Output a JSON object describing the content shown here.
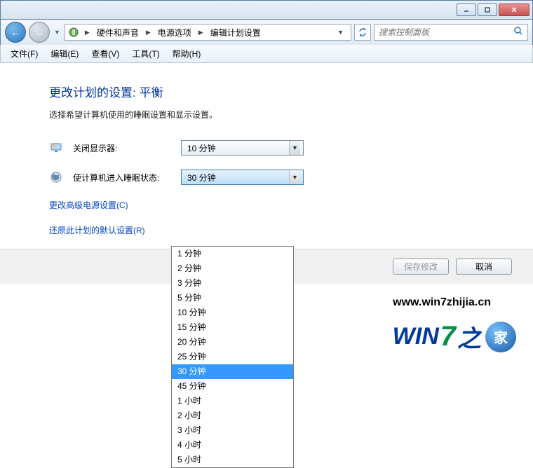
{
  "titlebar": {
    "min": "_",
    "max": "□",
    "close": "✕"
  },
  "nav": {
    "back": "←",
    "fwd": "→"
  },
  "breadcrumb": {
    "c1": "硬件和声音",
    "c2": "电源选项",
    "c3": "编辑计划设置"
  },
  "search": {
    "placeholder": "搜索控制面板"
  },
  "menu": {
    "file": "文件(F)",
    "edit": "编辑(E)",
    "view": "查看(V)",
    "tools": "工具(T)",
    "help": "帮助(H)"
  },
  "page": {
    "heading": "更改计划的设置: 平衡",
    "sub": "选择希望计算机使用的睡眠设置和显示设置。",
    "row1_label": "关闭显示器:",
    "row1_value": "10 分钟",
    "row2_label": "使计算机进入睡眠状态:",
    "row2_value": "30 分钟",
    "link1": "更改高级电源设置(C)",
    "link2": "还原此计划的默认设置(R)"
  },
  "dropdown": {
    "o1": "1 分钟",
    "o2": "2 分钟",
    "o3": "3 分钟",
    "o4": "5 分钟",
    "o5": "10 分钟",
    "o6": "15 分钟",
    "o7": "20 分钟",
    "o8": "25 分钟",
    "o9": "30 分钟",
    "o10": "45 分钟",
    "o11": "1 小时",
    "o12": "2 小时",
    "o13": "3 小时",
    "o14": "4 小时",
    "o15": "5 小时"
  },
  "buttons": {
    "save": "保存修改",
    "cancel": "取消"
  },
  "watermark": {
    "url": "www.win7zhijia.cn",
    "brand1": "WIN",
    "seven": "7",
    "brand2": "之",
    "orb": "家"
  }
}
